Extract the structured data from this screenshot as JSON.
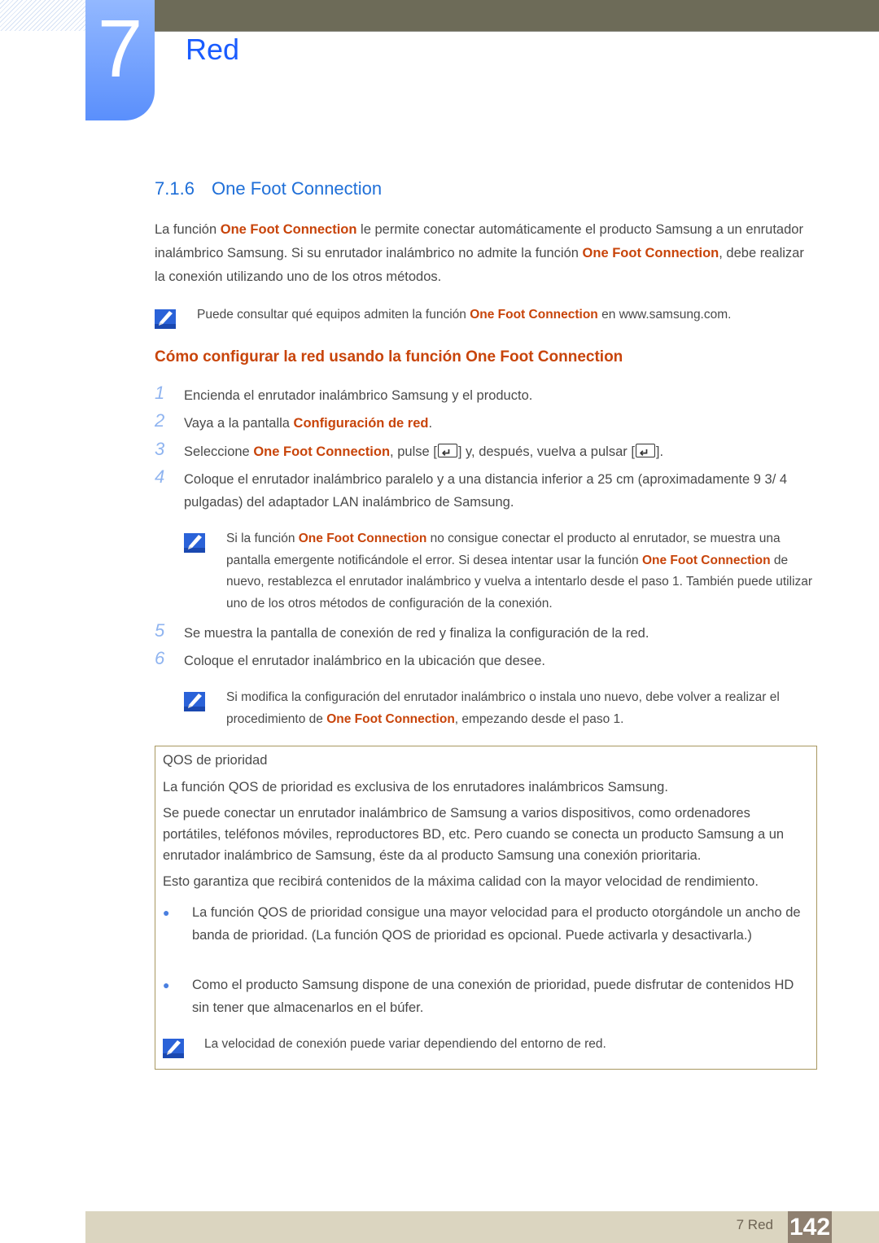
{
  "chapter": {
    "number": "7",
    "title": "Red"
  },
  "section": {
    "number": "7.1.6",
    "title": "One Foot Connection"
  },
  "intro": [
    {
      "t": "La función "
    },
    {
      "t": "One Foot Connection",
      "hl": true
    },
    {
      "t": " le permite conectar automáticamente el producto Samsung a un enrutador inalámbrico Samsung. Si su enrutador inalámbrico no admite la función "
    },
    {
      "t": "One Foot Connection",
      "hl": true
    },
    {
      "t": ", debe realizar la conexión utilizando uno de los otros métodos."
    }
  ],
  "note1": [
    {
      "t": "Puede consultar qué equipos admiten la función "
    },
    {
      "t": "One Foot Connection",
      "hl": true
    },
    {
      "t": " en www.samsung.com."
    }
  ],
  "subheading": "Cómo configurar la red usando la función One Foot Connection",
  "steps": [
    {
      "num": "1",
      "text": [
        {
          "t": "Encienda el enrutador inalámbrico Samsung y el producto."
        }
      ]
    },
    {
      "num": "2",
      "text": [
        {
          "t": "Vaya a la pantalla "
        },
        {
          "t": "Configuración de red",
          "hl": true
        },
        {
          "t": "."
        }
      ]
    },
    {
      "num": "3",
      "text": [
        {
          "t": "Seleccione "
        },
        {
          "t": "One Foot Connection",
          "hl": true
        },
        {
          "t": ", pulse ["
        },
        {
          "key": "enter-icon"
        },
        {
          "t": "] y, después, vuelva a pulsar ["
        },
        {
          "key": "enter-icon"
        },
        {
          "t": "]."
        }
      ]
    },
    {
      "num": "4",
      "text": [
        {
          "t": "Coloque el enrutador inalámbrico paralelo y a una distancia inferior a 25 cm (aproximadamente 9 3/ 4 pulgadas) del adaptador LAN inalámbrico de Samsung."
        }
      ]
    },
    {
      "num": "5",
      "text": [
        {
          "t": "Se muestra la pantalla de conexión de red y finaliza la configuración de la red."
        }
      ]
    },
    {
      "num": "6",
      "text": [
        {
          "t": "Coloque el enrutador inalámbrico en la ubicación que desee."
        }
      ]
    }
  ],
  "note2": [
    {
      "t": "Si la función "
    },
    {
      "t": "One Foot Connection",
      "hl": true
    },
    {
      "t": " no consigue conectar el producto al enrutador, se muestra una pantalla emergente notificándole el error. Si desea intentar usar la función "
    },
    {
      "t": "One Foot Connection",
      "hl": true
    },
    {
      "t": " de nuevo, restablezca el enrutador inalámbrico y vuelva a intentarlo desde el paso 1. También puede utilizar uno de los otros métodos de configuración de la conexión."
    }
  ],
  "note3": [
    {
      "t": "Si modifica la configuración del enrutador inalámbrico o instala uno nuevo, debe volver a realizar el procedimiento de "
    },
    {
      "t": "One Foot Connection",
      "hl": true
    },
    {
      "t": ", empezando desde el paso 1."
    }
  ],
  "qos": {
    "title": "QOS de prioridad",
    "p1": "La función QOS de prioridad es exclusiva de los enrutadores inalámbricos Samsung.",
    "p2": "Se puede conectar un enrutador inalámbrico de Samsung a varios dispositivos, como ordenadores portátiles, teléfonos móviles, reproductores BD, etc. Pero cuando se conecta un producto Samsung a un enrutador inalámbrico de Samsung, éste da al producto Samsung una conexión prioritaria.",
    "p3": "Esto garantiza que recibirá contenidos de la máxima calidad con la mayor velocidad de rendimiento.",
    "bullets": [
      "La función QOS de prioridad consigue una mayor velocidad para el producto otorgándole un ancho de banda de prioridad. (La función QOS de prioridad es opcional. Puede activarla y desactivarla.)",
      "Como el producto Samsung dispone de una conexión de prioridad, puede disfrutar de contenidos HD sin tener que almacenarlos en el búfer."
    ],
    "note": "La velocidad de conexión puede variar dependiendo del entorno de red."
  },
  "footer": {
    "chapter_label": "7 Red",
    "page_number": "142"
  },
  "colors": {
    "accent_blue": "#1a5cff",
    "highlight": "#c8440a",
    "header_bar": "#6d6b58",
    "footer_bar": "#dbd5c0"
  }
}
